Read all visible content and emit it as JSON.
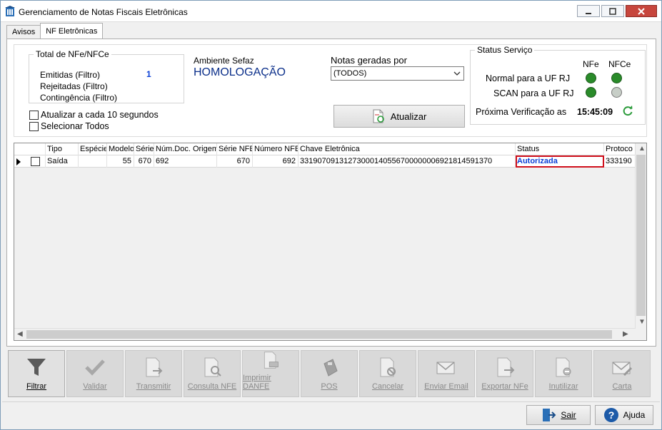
{
  "window": {
    "title": "Gerenciamento de Notas Fiscais Eletrônicas"
  },
  "tabs": [
    {
      "label": "Avisos"
    },
    {
      "label": "NF Eletrônicas"
    }
  ],
  "totals": {
    "legend": "Total de NFe/NFCe",
    "emitidas_label": "Emitidas (Filtro)",
    "emitidas_value": "1",
    "rejeitadas_label": "Rejeitadas (Filtro)",
    "contingencia_label": "Contingência (Filtro)"
  },
  "ambiente": {
    "label": "Ambiente Sefaz",
    "value": "HOMOLOGAÇÃO"
  },
  "notas_geradas": {
    "label": "Notas geradas por",
    "selected": "(TODOS)"
  },
  "refresh_button": {
    "label": "Atualizar"
  },
  "options": {
    "auto_refresh": "Atualizar a cada 10 segundos",
    "select_all": "Selecionar Todos"
  },
  "status_servico": {
    "legend": "Status Serviço",
    "col_nfe": "NFe",
    "col_nfce": "NFCe",
    "normal_label": "Normal para a UF RJ",
    "scan_label": "SCAN para a UF RJ",
    "proxima_label": "Próxima Verificação as",
    "proxima_time": "15:45:09",
    "indicators": {
      "normal_nfe": "on",
      "normal_nfce": "on",
      "scan_nfe": "on",
      "scan_nfce": "off"
    }
  },
  "grid": {
    "headers": [
      "Tipo",
      "Espécie",
      "Modelo",
      "Série",
      "Núm.Doc. Origem",
      "Série NFE",
      "Número NFE",
      "Chave Eletrônica",
      "Status",
      "Protoco"
    ],
    "row": {
      "tipo": "Saída",
      "especie": "",
      "modelo": "55",
      "serie": "670",
      "num_doc": "692",
      "serie_nfe": "670",
      "numero_nfe": "692",
      "chave": "33190709131273000140556700000006921814591370",
      "status": "Autorizada",
      "protocolo": "333190"
    }
  },
  "toolbar": [
    {
      "label": "Filtrar",
      "icon": "funnel-icon",
      "enabled": true
    },
    {
      "label": "Validar",
      "icon": "check-icon",
      "enabled": false
    },
    {
      "label": "Transmitir",
      "icon": "transmit-doc-icon",
      "enabled": false
    },
    {
      "label": "Consulta NFE",
      "icon": "search-doc-icon",
      "enabled": false
    },
    {
      "label": "Imprimir DANFE",
      "icon": "print-doc-icon",
      "enabled": false
    },
    {
      "label": "POS",
      "icon": "pos-icon",
      "enabled": false
    },
    {
      "label": "Cancelar",
      "icon": "cancel-doc-icon",
      "enabled": false
    },
    {
      "label": "Enviar Email",
      "icon": "email-icon",
      "enabled": false
    },
    {
      "label": "Exportar NFe",
      "icon": "export-doc-icon",
      "enabled": false
    },
    {
      "label": "Inutilizar",
      "icon": "void-doc-icon",
      "enabled": false
    },
    {
      "label": "Carta",
      "icon": "letter-icon",
      "enabled": false
    }
  ],
  "footer": {
    "sair_label": "Sair",
    "ajuda_label": "Ajuda"
  }
}
